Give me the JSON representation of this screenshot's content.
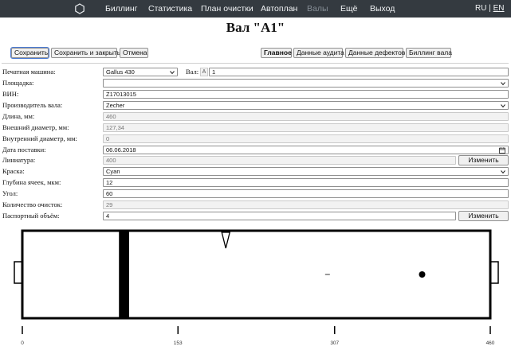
{
  "nav": {
    "items": [
      {
        "label": "Биллинг",
        "disabled": false
      },
      {
        "label": "Статистика",
        "disabled": false
      },
      {
        "label": "План очистки",
        "disabled": false
      },
      {
        "label": "Автоплан",
        "disabled": false
      },
      {
        "label": "Валы",
        "disabled": true
      },
      {
        "label": "Ещё",
        "disabled": false
      },
      {
        "label": "Выход",
        "disabled": false
      }
    ],
    "lang_ru": "RU",
    "lang_sep": "|",
    "lang_en": "EN",
    "logo_icon": "hexagon-icon"
  },
  "page": {
    "title": "Вал \"A1\""
  },
  "actions": {
    "save": "Сохранить",
    "save_close": "Сохранить и закрыть",
    "cancel": "Отмена"
  },
  "tabs": [
    {
      "label": "Главное",
      "active": true
    },
    {
      "label": "Данные аудита",
      "active": false
    },
    {
      "label": "Данные дефектов",
      "active": false
    },
    {
      "label": "Биллинг вала",
      "active": false
    }
  ],
  "form": {
    "press": {
      "label": "Печатная машина:",
      "value": "Gallus 430"
    },
    "roll": {
      "label": "Вал:",
      "prefix": "A",
      "value": "1"
    },
    "site": {
      "label": "Площадка:",
      "value": ""
    },
    "vin": {
      "label": "ВИН:",
      "value": "Z17013015"
    },
    "manufacturer": {
      "label": "Производитель вала:",
      "value": "Zecher"
    },
    "length": {
      "label": "Длина, мм:",
      "value": "460"
    },
    "outer_d": {
      "label": "Внешний диаметр, мм:",
      "value": "127,34"
    },
    "inner_d": {
      "label": "Внутренний диаметр, мм:",
      "value": "0"
    },
    "delivery": {
      "label": "Дата поставки:",
      "value": "06.06.2018"
    },
    "lineature": {
      "label": "Линиатура:",
      "value": "400",
      "button": "Изменить"
    },
    "paint": {
      "label": "Краска:",
      "value": "Cyan"
    },
    "cell_depth": {
      "label": "Глубина ячеек, мкм:",
      "value": "12"
    },
    "angle": {
      "label": "Угол:",
      "value": "60"
    },
    "cleanings": {
      "label": "Количество очисток:",
      "value": "29"
    },
    "volume": {
      "label": "Паспортный объём:",
      "value": "4",
      "button": "Изменить"
    }
  },
  "roll_diagram": {
    "length_mm": 460,
    "band_mm": [
      95,
      105
    ],
    "marker_triangle_mm": 200,
    "dash_mark_mm": 300,
    "dot_mark_mm": 393,
    "ticks": [
      {
        "value": 0,
        "label": "0"
      },
      {
        "value": 153,
        "label": "153"
      },
      {
        "value": 307,
        "label": "307"
      },
      {
        "value": 460,
        "label": "460"
      }
    ]
  }
}
